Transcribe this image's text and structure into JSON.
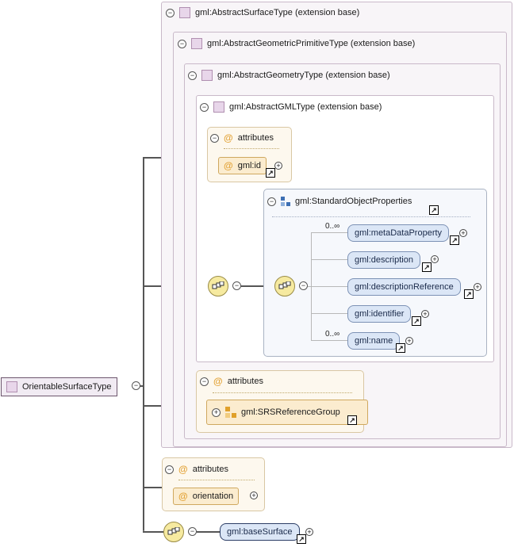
{
  "root": {
    "label": "OrientableSurfaceType"
  },
  "extensions": [
    {
      "label": "gml:AbstractSurfaceType (extension base)"
    },
    {
      "label": "gml:AbstractGeometricPrimitiveType (extension base)"
    },
    {
      "label": "gml:AbstractGeometryType (extension base)"
    },
    {
      "label": "gml:AbstractGMLType (extension base)"
    }
  ],
  "gml_type_attributes": {
    "title": "attributes",
    "items": [
      "gml:id"
    ]
  },
  "standard_object_properties": {
    "title": "gml:StandardObjectProperties",
    "elements": [
      {
        "label": "gml:metaDataProperty",
        "occurrence": "0..∞"
      },
      {
        "label": "gml:description",
        "occurrence": ""
      },
      {
        "label": "gml:descriptionReference",
        "occurrence": ""
      },
      {
        "label": "gml:identifier",
        "occurrence": ""
      },
      {
        "label": "gml:name",
        "occurrence": "0..∞"
      }
    ]
  },
  "geometry_attributes": {
    "title": "attributes",
    "group": "gml:SRSReferenceGroup"
  },
  "own_attributes": {
    "title": "attributes",
    "items": [
      "orientation"
    ]
  },
  "base_surface": {
    "label": "gml:baseSurface"
  },
  "colors": {
    "attribute": "#fbeccf",
    "element": "#dbe6f6",
    "compositor": "#f6eaa0",
    "type": "#e8d6ea"
  }
}
